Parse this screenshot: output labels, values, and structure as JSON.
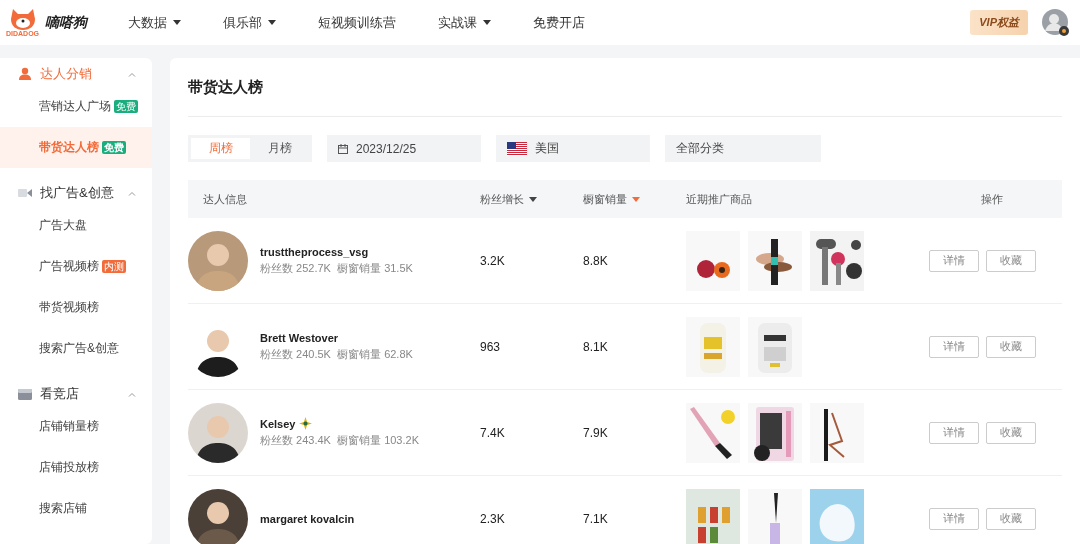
{
  "logo": {
    "name": "嘀嗒狗",
    "sub": "DIDADOG"
  },
  "nav": [
    {
      "label": "大数据",
      "has_menu": true
    },
    {
      "label": "俱乐部",
      "has_menu": true
    },
    {
      "label": "短视频训练营",
      "has_menu": false
    },
    {
      "label": "实战课",
      "has_menu": true
    },
    {
      "label": "免费开店",
      "has_menu": false
    }
  ],
  "vip": {
    "label": "VIP权益"
  },
  "sidebar": [
    {
      "label": "达人分销",
      "kind": "person",
      "expanded": true,
      "selected": true,
      "children": [
        {
          "label": "营销达人广场",
          "selected": false,
          "badge": {
            "text": "免费",
            "color": "#1aad7e"
          }
        },
        {
          "label": "带货达人榜",
          "selected": true,
          "badge": {
            "text": "免费",
            "color": "#1aad7e"
          }
        }
      ]
    },
    {
      "label": "找广告&创意",
      "kind": "video",
      "expanded": true,
      "selected": false,
      "children": [
        {
          "label": "广告大盘",
          "selected": false
        },
        {
          "label": "广告视频榜",
          "selected": false,
          "badge": {
            "text": "内测",
            "color": "#f26b3a"
          }
        },
        {
          "label": "带货视频榜",
          "selected": false
        },
        {
          "label": "搜索广告&创意",
          "selected": false
        }
      ]
    },
    {
      "label": "看竞店",
      "kind": "store",
      "expanded": true,
      "selected": false,
      "children": [
        {
          "label": "店铺销量榜",
          "selected": false
        },
        {
          "label": "店铺投放榜",
          "selected": false
        },
        {
          "label": "搜索店铺",
          "selected": false
        }
      ]
    }
  ],
  "page_title": "带货达人榜",
  "period_tabs": [
    {
      "label": "周榜",
      "selected": true
    },
    {
      "label": "月榜",
      "selected": false
    }
  ],
  "date": "2023/12/25",
  "country": "美国",
  "category": "全部分类",
  "table": {
    "columns": [
      {
        "label": "达人信息"
      },
      {
        "label": "粉丝增长",
        "sortable": true,
        "sorted": false
      },
      {
        "label": "橱窗销量",
        "sortable": true,
        "sorted": true
      },
      {
        "label": "近期推广商品"
      },
      {
        "label": "操作"
      }
    ],
    "rows": [
      {
        "name": "trusttheprocess_vsg",
        "followers_label": "粉丝数",
        "followers": "252.7K",
        "sales_label": "橱窗销量",
        "sales": "31.5K",
        "fan_growth": "3.2K",
        "window_sales": "8.8K",
        "products": [
          {
            "kind": "picture"
          },
          {
            "kind": "picture"
          },
          {
            "kind": "picture"
          }
        ],
        "actions": [
          "详情",
          "收藏"
        ]
      },
      {
        "name": "Brett Westover",
        "followers_label": "粉丝数",
        "followers": "240.5K",
        "sales_label": "橱窗销量",
        "sales": "62.8K",
        "fan_growth": "963",
        "window_sales": "8.1K",
        "products": [
          {
            "kind": "picture"
          },
          {
            "kind": "picture"
          }
        ],
        "actions": [
          "详情",
          "收藏"
        ]
      },
      {
        "name": "Kelsey",
        "verified": true,
        "followers_label": "粉丝数",
        "followers": "243.4K",
        "sales_label": "橱窗销量",
        "sales": "103.2K",
        "fan_growth": "7.4K",
        "window_sales": "7.9K",
        "products": [
          {
            "kind": "picture"
          },
          {
            "kind": "picture"
          },
          {
            "kind": "picture"
          }
        ],
        "actions": [
          "详情",
          "收藏"
        ]
      },
      {
        "name": "margaret kovalcin",
        "fan_growth": "2.3K",
        "window_sales": "7.1K",
        "products": [
          {
            "kind": "picture"
          },
          {
            "kind": "picture"
          },
          {
            "kind": "picture"
          }
        ],
        "actions": [
          "详情",
          "收藏"
        ]
      }
    ]
  }
}
